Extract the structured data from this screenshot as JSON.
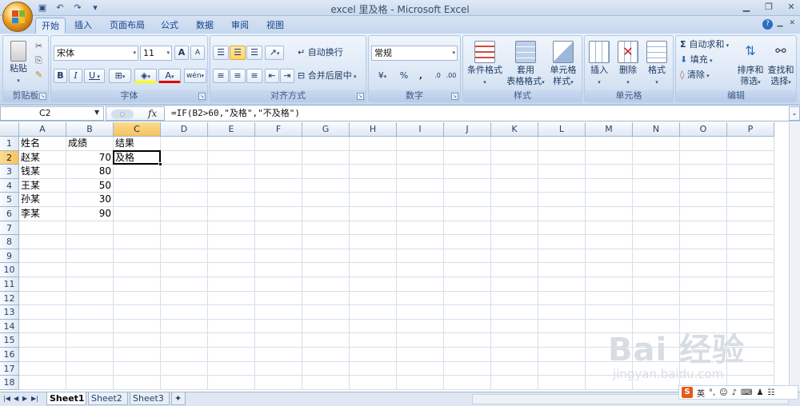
{
  "window": {
    "title": "excel 里及格 - Microsoft Excel"
  },
  "qat": [
    "save-icon",
    "undo-icon",
    "redo-icon",
    "customize-icon"
  ],
  "tabs": [
    "开始",
    "插入",
    "页面布局",
    "公式",
    "数据",
    "审阅",
    "视图"
  ],
  "active_tab": "开始",
  "ribbon": {
    "clipboard": {
      "label": "剪贴板",
      "paste": "粘贴"
    },
    "font": {
      "label": "字体",
      "name": "宋体",
      "size": "11",
      "bold": "B",
      "italic": "I",
      "underline": "U",
      "grow": "A",
      "shrink": "A",
      "font_color": "A",
      "phonetic": "wén"
    },
    "alignment": {
      "label": "对齐方式",
      "wrap": "自动换行",
      "merge": "合并后居中"
    },
    "number": {
      "label": "数字",
      "format": "常规",
      "percent": "%",
      "comma": ","
    },
    "styles": {
      "label": "样式",
      "conditional_l1": "条件格式",
      "table_l1": "套用",
      "table_l2": "表格格式",
      "cell_l1": "单元格",
      "cell_l2": "样式"
    },
    "cells": {
      "label": "单元格",
      "insert": "插入",
      "delete": "删除",
      "format": "格式"
    },
    "editing": {
      "label": "编辑",
      "autosum": "自动求和",
      "fill": "填充",
      "clear": "清除",
      "sort_l1": "排序和",
      "sort_l2": "筛选",
      "find_l1": "查找和",
      "find_l2": "选择"
    }
  },
  "formula_bar": {
    "name_box": "C2",
    "fx": "fx",
    "formula": "=IF(B2>60,\"及格\",\"不及格\")"
  },
  "columns": [
    "A",
    "B",
    "C",
    "D",
    "E",
    "F",
    "G",
    "H",
    "I",
    "J",
    "K",
    "L",
    "M",
    "N",
    "O",
    "P"
  ],
  "selected_column": "C",
  "rows": [
    "1",
    "2",
    "3",
    "4",
    "5",
    "6",
    "7",
    "8",
    "9",
    "10",
    "11",
    "12",
    "13",
    "14",
    "15",
    "16",
    "17",
    "18"
  ],
  "selected_row": "2",
  "cells": {
    "headers": [
      "姓名",
      "成绩",
      "结果"
    ],
    "data": [
      {
        "name": "赵某",
        "score": "70",
        "result": "及格"
      },
      {
        "name": "钱某",
        "score": "80",
        "result": ""
      },
      {
        "name": "王某",
        "score": "50",
        "result": ""
      },
      {
        "name": "孙某",
        "score": "30",
        "result": ""
      },
      {
        "name": "李某",
        "score": "90",
        "result": ""
      }
    ]
  },
  "sheets": [
    "Sheet1",
    "Sheet2",
    "Sheet3"
  ],
  "active_sheet": "Sheet1",
  "watermark": {
    "logo": "Bai 经验",
    "url": "jingyan.baidu.com"
  },
  "ime": {
    "label": "英"
  }
}
